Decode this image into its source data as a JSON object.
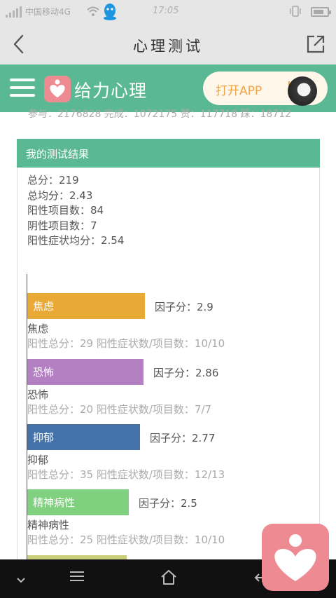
{
  "status_bar": {
    "carrier": "中国移动4G",
    "time": "17:05",
    "icons": [
      "signal-icon",
      "wifi-icon",
      "qq-icon",
      "vibrate-icon",
      "battery-icon"
    ]
  },
  "title_bar": {
    "title": "心理测试",
    "icons": [
      "back-arrow-icon",
      "share-icon"
    ]
  },
  "app_header": {
    "brand": "给力心理",
    "open_app_label": "打开APP",
    "accent_color": "#5bb894",
    "icons": [
      "menu-icon",
      "heart-logo-icon",
      "avatar"
    ]
  },
  "clipped_line": "参与：2176828  完成：1072175  赞：117718  踩：18712",
  "result": {
    "heading": "我的测试结果",
    "stats": [
      "总分：219",
      "总均分：2.43",
      "阳性项目数：84",
      "阴性项目数：7",
      "阳性症状均分：2.54"
    ],
    "factors": [
      {
        "name": "焦虑",
        "score": 2.9,
        "score_label": "因子分：2.9",
        "color": "#e9a937",
        "detail": "阳性总分：29    阳性症状数/项目数：10/10"
      },
      {
        "name": "恐怖",
        "score": 2.86,
        "score_label": "因子分：2.86",
        "color": "#b57fc3",
        "detail": "阳性总分：20    阳性症状数/项目数：7/7"
      },
      {
        "name": "抑郁",
        "score": 2.77,
        "score_label": "因子分：2.77",
        "color": "#4573a9",
        "detail": "阳性总分：35    阳性症状数/项目数：12/13"
      },
      {
        "name": "精神病性",
        "score": 2.5,
        "score_label": "因子分：2.5",
        "color": "#7fd17f",
        "detail": "阳性总分：25    阳性症状数/项目数：10/10"
      },
      {
        "name": "",
        "score": 2.45,
        "score_label": "",
        "color": "#c9ce7a",
        "detail": ""
      }
    ]
  },
  "nav_bar": {
    "icons": [
      "chevron-down-icon",
      "menu-lines-icon",
      "home-icon",
      "back-icon"
    ]
  }
}
